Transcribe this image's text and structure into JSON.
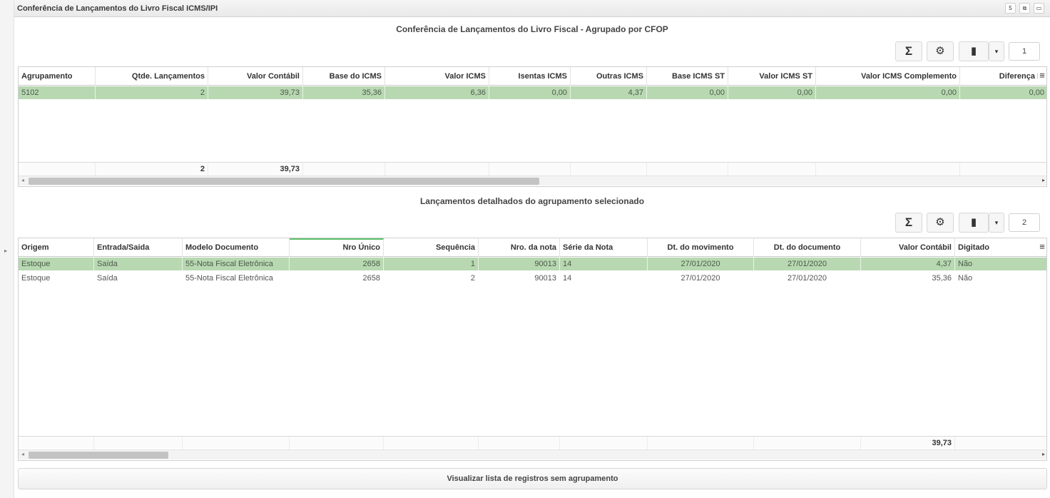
{
  "window": {
    "title": "Conferência de Lançamentos do Livro Fiscal ICMS/IPI",
    "btn_restore": "5",
    "btn_tile": "⧉",
    "btn_max": "▭"
  },
  "grid1": {
    "title": "Conferência de Lançamentos do Livro Fiscal - Agrupado por CFOP",
    "page": "1",
    "headers": [
      "Agrupamento",
      "Qtde. Lançamentos",
      "Valor Contábil",
      "Base do ICMS",
      "Valor ICMS",
      "Isentas ICMS",
      "Outras ICMS",
      "Base ICMS ST",
      "Valor ICMS ST",
      "Valor ICMS Complemento",
      "Diferença IC"
    ],
    "rows": [
      [
        "5102",
        "2",
        "39,73",
        "35,36",
        "6,36",
        "0,00",
        "4,37",
        "0,00",
        "0,00",
        "0,00",
        "0,00"
      ]
    ],
    "totals": {
      "qtde": "2",
      "valor_contabil": "39,73"
    },
    "scroll_fraction": 0.5
  },
  "grid2": {
    "title": "Lançamentos detalhados do agrupamento selecionado",
    "page": "2",
    "headers": [
      "Origem",
      "Entrada/Saida",
      "Modelo Documento",
      "Nro Único",
      "Sequência",
      "Nro. da nota",
      "Série da Nota",
      "Dt. do movimento",
      "Dt. do documento",
      "Valor Contábil",
      "Digitado"
    ],
    "rows": [
      [
        "Estoque",
        "Saída",
        "55-Nota Fiscal Eletrônica",
        "2658",
        "1",
        "90013",
        "14",
        "27/01/2020",
        "27/01/2020",
        "4,37",
        "Não"
      ],
      [
        "Estoque",
        "Saída",
        "55-Nota Fiscal Eletrônica",
        "2658",
        "2",
        "90013",
        "14",
        "27/01/2020",
        "27/01/2020",
        "35,36",
        "Não"
      ]
    ],
    "totals": {
      "valor_contabil": "39,73"
    },
    "scroll_fraction": 0.14
  },
  "toolbar": {
    "sigma": "Σ",
    "gear": "⚙",
    "export": "▮",
    "caret": "▾"
  },
  "bottom_button": "Visualizar lista de registros sem agrupamento"
}
